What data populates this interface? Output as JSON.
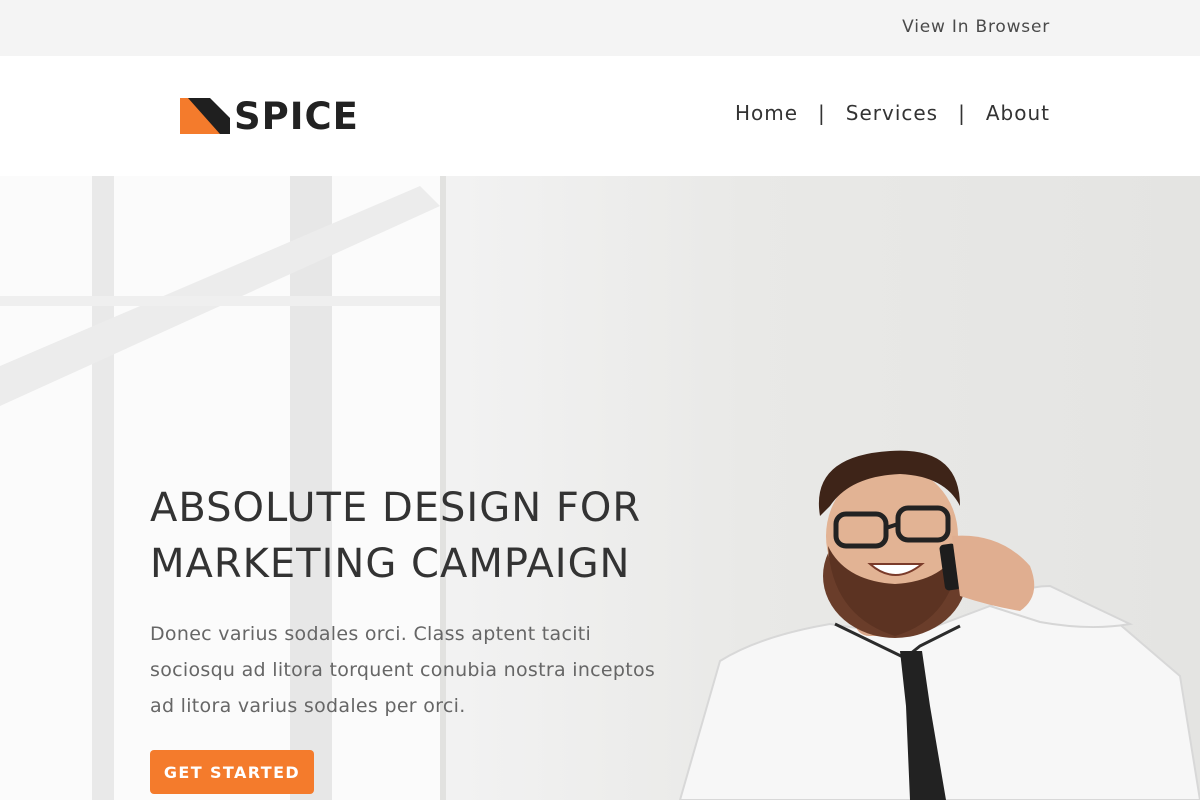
{
  "topbar": {
    "view_in_browser": "View In Browser"
  },
  "header": {
    "logo_text": "SPICE",
    "nav": [
      {
        "label": "Home"
      },
      {
        "label": "Services"
      },
      {
        "label": "About"
      }
    ],
    "nav_separator": "|"
  },
  "hero": {
    "title_line1": "ABSOLUTE DESIGN FOR",
    "title_line2": "MARKETING CAMPAIGN",
    "body": "Donec varius sodales orci. Class aptent taciti sociosqu ad litora torquent conubia nostra inceptos ad litora varius sodales per orci.",
    "cta_label": "GET STARTED",
    "image": "man-on-phone-photo"
  },
  "colors": {
    "accent": "#f47b2c",
    "topbar_bg": "#f4f4f4",
    "title_text": "#333333",
    "body_text": "#666666"
  },
  "icons": {
    "logo_mark": "spice-logo-mark"
  }
}
